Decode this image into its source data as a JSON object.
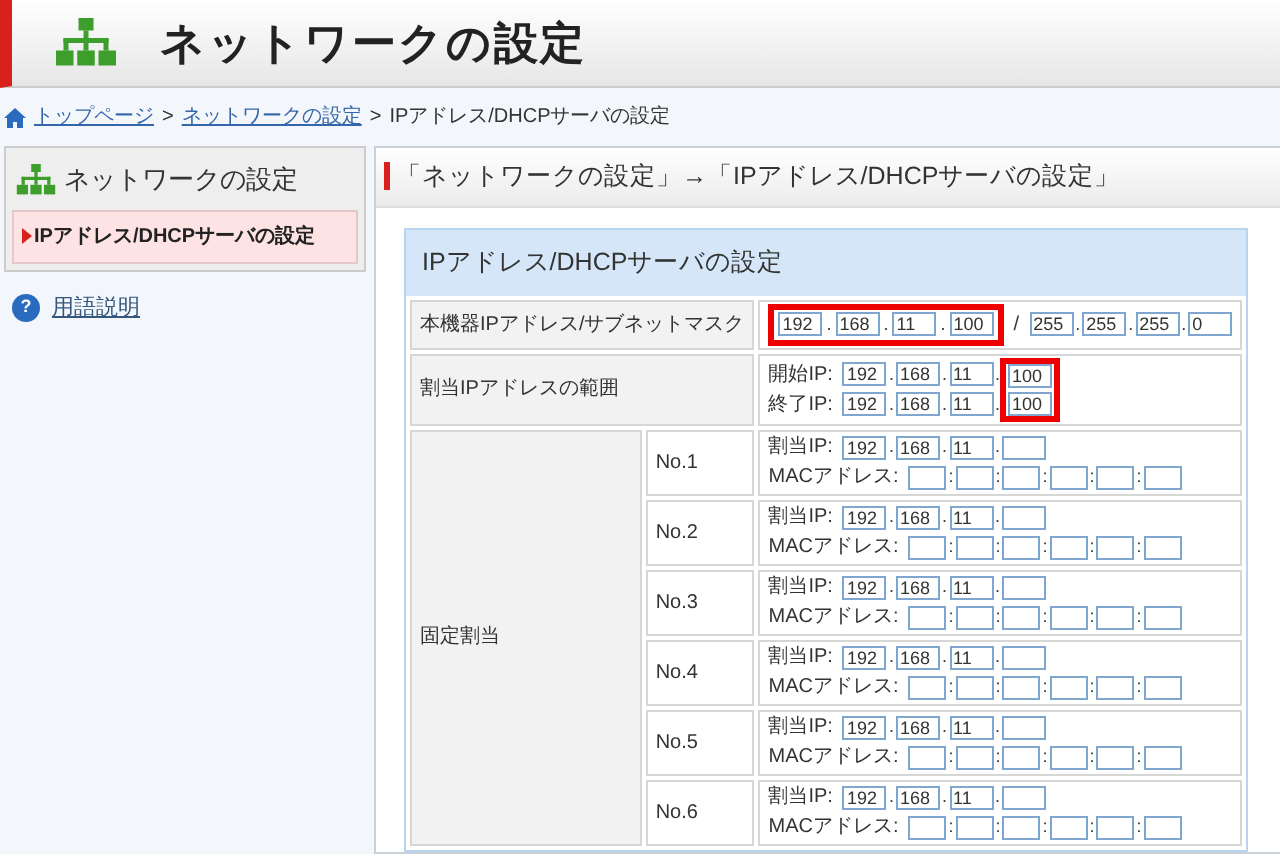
{
  "header": {
    "title": "ネットワークの設定"
  },
  "breadcrumb": [
    {
      "kind": "link",
      "text": "トップページ"
    },
    {
      "kind": "separator",
      "text": ">"
    },
    {
      "kind": "link",
      "text": "ネットワークの設定"
    },
    {
      "kind": "separator",
      "text": ">"
    },
    {
      "kind": "current",
      "text": "IPアドレス/DHCPサーバの設定"
    }
  ],
  "sidebar": {
    "title": "ネットワークの設定",
    "items": [
      {
        "label": "IPアドレス/DHCPサーバの設定",
        "selected": true
      }
    ],
    "help": {
      "glyph": "?",
      "label": "用語説明"
    }
  },
  "main": {
    "heading": "「ネットワークの設定」→「IPアドレス/DHCPサーバの設定」",
    "panel_title": "IPアドレス/DHCPサーバの設定",
    "ip_separator": ".",
    "mac_separator": ":",
    "device_ip": {
      "label": "本機器IPアドレス/サブネットマスク",
      "ip": [
        "192",
        "168",
        "11",
        "100"
      ],
      "ip_highlighted": true,
      "separator": "/",
      "mask": [
        "255",
        "255",
        "255",
        "0"
      ]
    },
    "range": {
      "label": "割当IPアドレスの範囲",
      "start_label": "開始IP:",
      "start": [
        "192",
        "168",
        "11",
        "100"
      ],
      "end_label": "終了IP:",
      "end": [
        "192",
        "168",
        "11",
        "100"
      ],
      "last_octet_highlighted": true
    },
    "fixed": {
      "label": "固定割当",
      "entries": [
        {
          "no": "No.1",
          "ip_label": "割当IP:",
          "ip": [
            "192",
            "168",
            "11"
          ],
          "mac_label": "MACアドレス:"
        },
        {
          "no": "No.2",
          "ip_label": "割当IP:",
          "ip": [
            "192",
            "168",
            "11"
          ],
          "mac_label": "MACアドレス:"
        },
        {
          "no": "No.3",
          "ip_label": "割当IP:",
          "ip": [
            "192",
            "168",
            "11"
          ],
          "mac_label": "MACアドレス:"
        },
        {
          "no": "No.4",
          "ip_label": "割当IP:",
          "ip": [
            "192",
            "168",
            "11"
          ],
          "mac_label": "MACアドレス:"
        },
        {
          "no": "No.5",
          "ip_label": "割当IP:",
          "ip": [
            "192",
            "168",
            "11"
          ],
          "mac_label": "MACアドレス:"
        },
        {
          "no": "No.6",
          "ip_label": "割当IP:",
          "ip": [
            "192",
            "168",
            "11"
          ],
          "mac_label": "MACアドレス:"
        }
      ]
    }
  }
}
